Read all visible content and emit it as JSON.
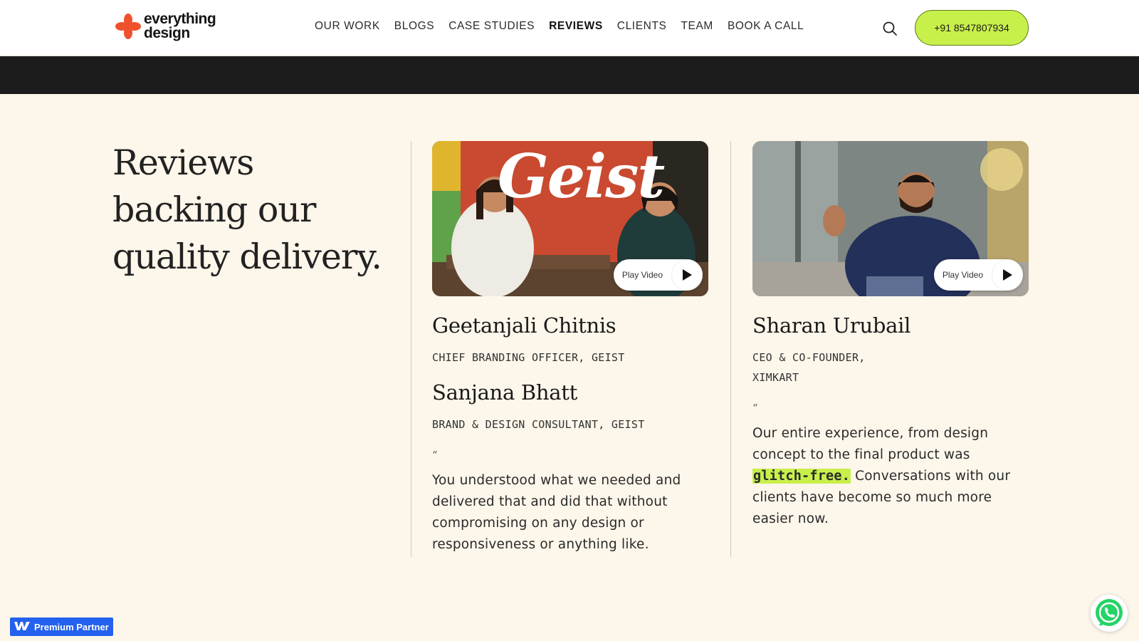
{
  "brand": {
    "line1": "everything",
    "line2": "design",
    "color": "#f0512d"
  },
  "nav": {
    "items": [
      {
        "label": "OUR WORK"
      },
      {
        "label": "BLOGS"
      },
      {
        "label": "CASE STUDIES"
      },
      {
        "label": "REVIEWS",
        "active": true
      },
      {
        "label": "CLIENTS"
      },
      {
        "label": "TEAM"
      },
      {
        "label": "BOOK A CALL"
      }
    ],
    "search_icon": "search-icon",
    "phone": "+91 8547807934",
    "accent": "#c8f04b"
  },
  "section": {
    "title_line1": "Reviews",
    "title_line2": "backing our",
    "title_line3": "quality delivery."
  },
  "reviews": [
    {
      "video_text": "Geist",
      "play_label": "Play Video",
      "people": [
        {
          "name": "Geetanjali Chitnis",
          "role": "CHIEF BRANDING OFFICER, GEIST"
        },
        {
          "name": "Sanjana Bhatt",
          "role": "BRAND & DESIGN CONSULTANT, GEIST"
        }
      ],
      "quote_mark": "“",
      "quote": "You understood what we needed and delivered that and did that without compromising on any design or responsiveness or anything like."
    },
    {
      "play_label": "Play Video",
      "people": [
        {
          "name": "Sharan Urubail",
          "role_line1": "CEO & CO-FOUNDER,",
          "role_line2": "XIMKART"
        }
      ],
      "quote_mark": "“",
      "quote_before": "Our entire experience, from design concept to the final product was ",
      "quote_highlight": "glitch-free.",
      "quote_after": " Conversations with our clients have become so much more easier now."
    }
  ],
  "badges": {
    "partner": "Premium Partner",
    "partner_icon": "webflow-icon",
    "whatsapp_icon": "whatsapp-icon"
  }
}
